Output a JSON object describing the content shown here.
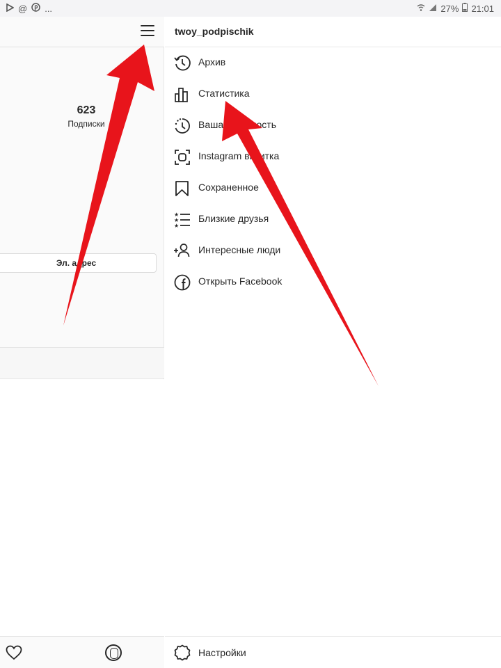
{
  "status_bar": {
    "left_icons": [
      "play-icon",
      "at-icon",
      "pinterest-icon"
    ],
    "left_ellipsis": "...",
    "battery": "27%",
    "time": "21:01"
  },
  "profile": {
    "following_count": "623",
    "following_label": "Подписки",
    "email_button": "Эл. адрес"
  },
  "drawer": {
    "username": "twoy_podpischik",
    "items": [
      {
        "label": "Архив",
        "icon": "archive-icon"
      },
      {
        "label": "Статистика",
        "icon": "bar-chart-icon"
      },
      {
        "label": "Ваша активность",
        "icon": "activity-icon"
      },
      {
        "label": "Instagram визитка",
        "icon": "nametag-icon"
      },
      {
        "label": "Сохраненное",
        "icon": "bookmark-icon"
      },
      {
        "label": "Близкие друзья",
        "icon": "close-friends-icon"
      },
      {
        "label": "Интересные люди",
        "icon": "add-person-icon"
      },
      {
        "label": "Открыть Facebook",
        "icon": "facebook-icon"
      }
    ],
    "settings_label": "Настройки"
  },
  "colors": {
    "arrow": "#e8141b",
    "text": "#262626",
    "divider": "#e8e8e8"
  }
}
